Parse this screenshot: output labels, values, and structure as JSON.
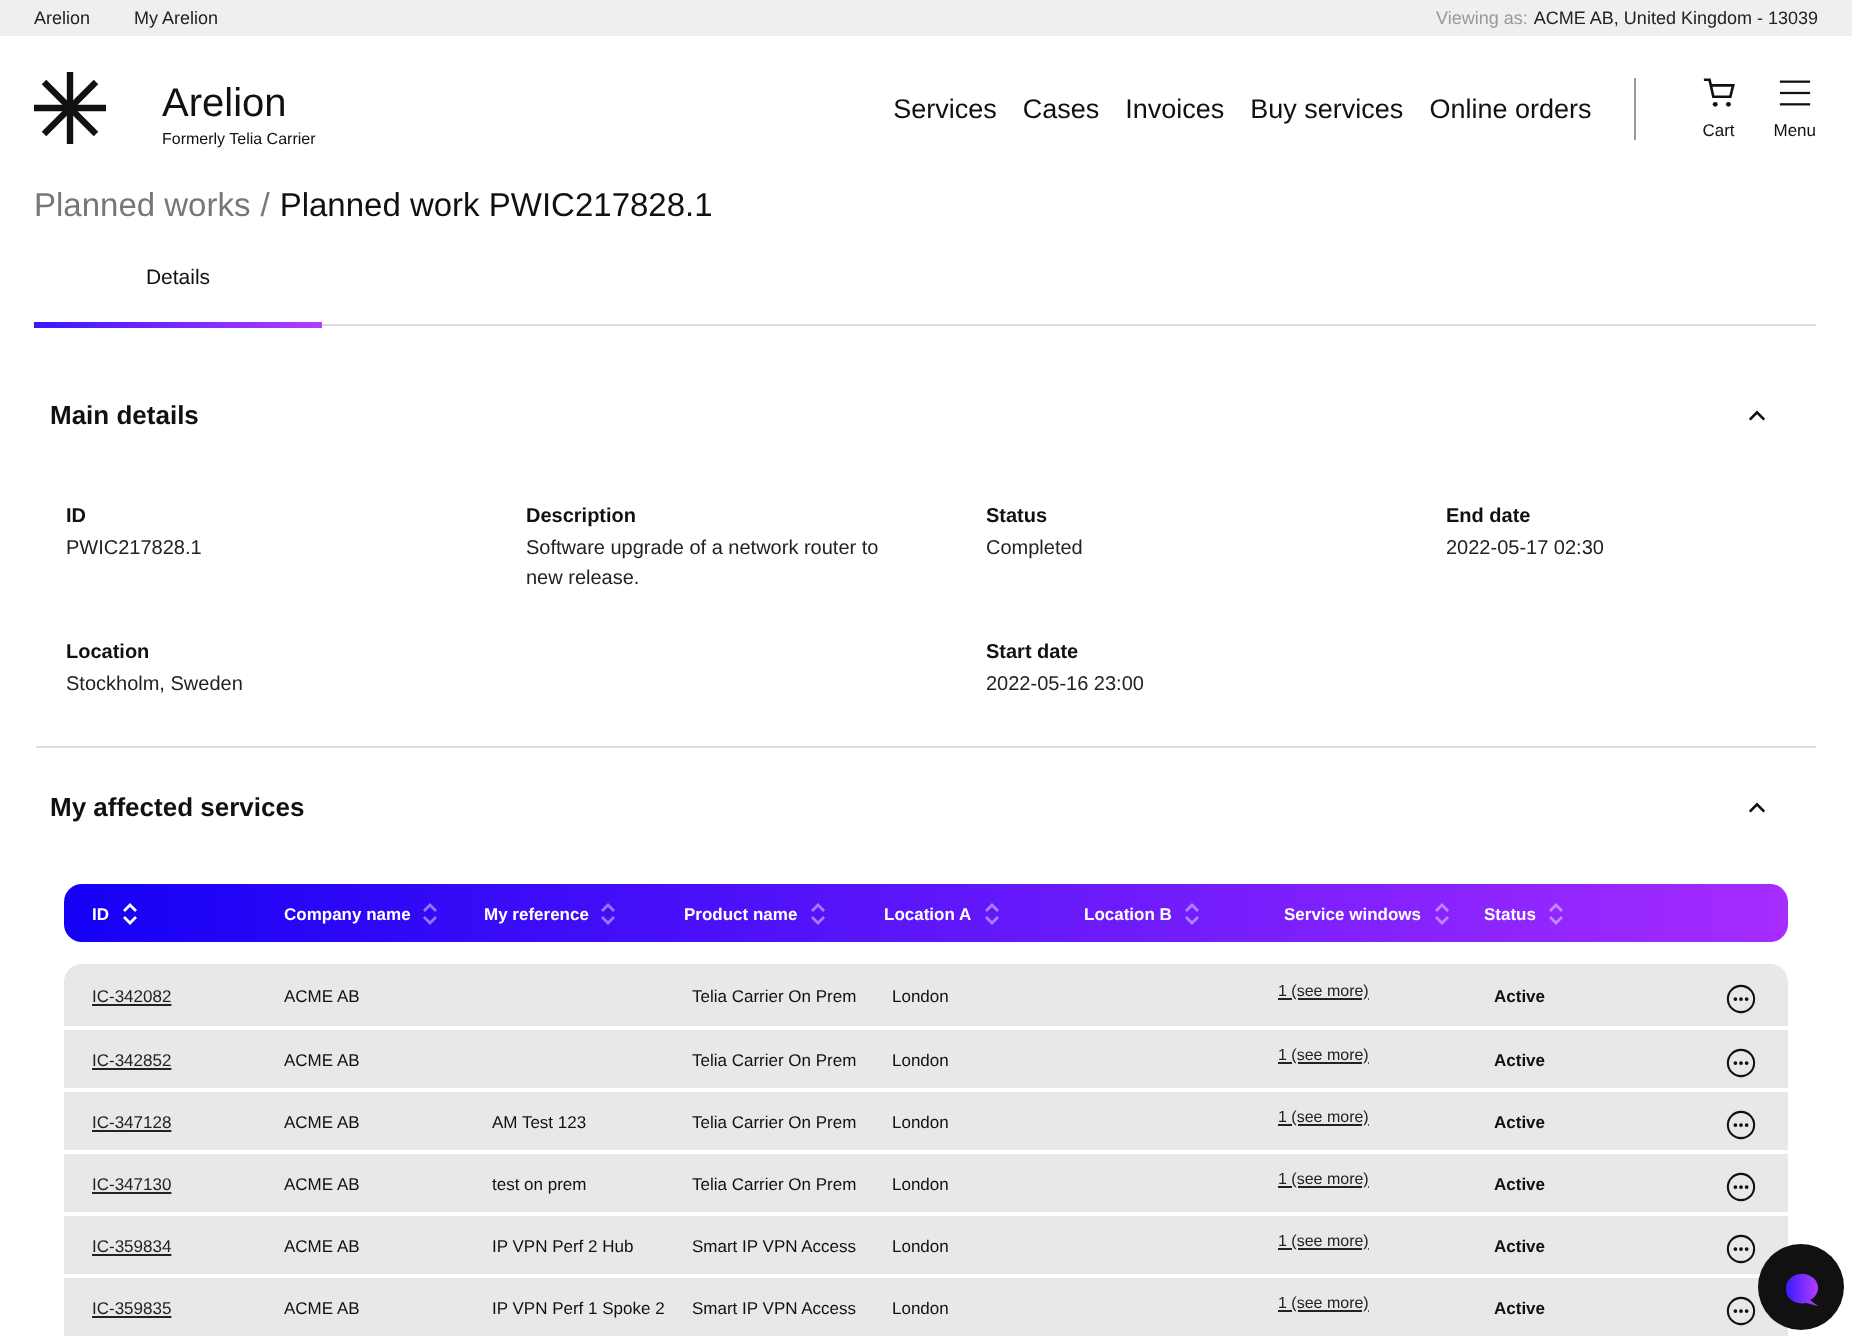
{
  "top_bar": {
    "links": [
      "Arelion",
      "My Arelion"
    ],
    "viewing_label": "Viewing as:",
    "viewing_value": "ACME AB, United Kingdom - 13039"
  },
  "header": {
    "brand": "Arelion",
    "tagline": "Formerly Telia Carrier",
    "nav": [
      "Services",
      "Cases",
      "Invoices",
      "Buy services",
      "Online orders"
    ],
    "cart": "Cart",
    "menu": "Menu"
  },
  "breadcrumb": {
    "parent": "Planned works",
    "separator": "/",
    "current": "Planned work PWIC217828.1"
  },
  "tabs": [
    {
      "label": "Details",
      "selected": true
    }
  ],
  "main_details": {
    "title": "Main details",
    "expanded": true,
    "fields": [
      {
        "label": "ID",
        "value": "PWIC217828.1"
      },
      {
        "label": "Description",
        "value": "Software upgrade of a network router to new release."
      },
      {
        "label": "Status",
        "value": "Completed"
      },
      {
        "label": "End date",
        "value": "2022-05-17 02:30"
      },
      {
        "label": "Location",
        "value": "Stockholm, Sweden"
      },
      {
        "label": "Start date",
        "value": "2022-05-16 23:00"
      }
    ]
  },
  "affected_services": {
    "title": "My affected services",
    "expanded": true,
    "columns": [
      {
        "label": "ID",
        "sorted": true
      },
      {
        "label": "Company name",
        "sorted": false
      },
      {
        "label": "My reference",
        "sorted": false
      },
      {
        "label": "Product name",
        "sorted": false
      },
      {
        "label": "Location A",
        "sorted": false
      },
      {
        "label": "Location B",
        "sorted": false
      },
      {
        "label": "Service windows",
        "sorted": false
      },
      {
        "label": "Status",
        "sorted": false
      }
    ],
    "rows": [
      {
        "id": "IC-342082",
        "company": "ACME AB",
        "reference": "",
        "product": "Telia Carrier On Prem",
        "location_a": "London",
        "location_b": "",
        "service_windows": "1 (see more)",
        "status": "Active"
      },
      {
        "id": "IC-342852",
        "company": "ACME AB",
        "reference": "",
        "product": "Telia Carrier On Prem",
        "location_a": "London",
        "location_b": "",
        "service_windows": "1 (see more)",
        "status": "Active"
      },
      {
        "id": "IC-347128",
        "company": "ACME AB",
        "reference": "AM Test 123",
        "product": "Telia Carrier On Prem",
        "location_a": "London",
        "location_b": "",
        "service_windows": "1 (see more)",
        "status": "Active"
      },
      {
        "id": "IC-347130",
        "company": "ACME AB",
        "reference": "test on prem",
        "product": "Telia Carrier On Prem",
        "location_a": "London",
        "location_b": "",
        "service_windows": "1 (see more)",
        "status": "Active"
      },
      {
        "id": "IC-359834",
        "company": "ACME AB",
        "reference": "IP VPN Perf 2 Hub",
        "product": "Smart IP VPN Access",
        "location_a": "London",
        "location_b": "",
        "service_windows": "1 (see more)",
        "status": "Active"
      },
      {
        "id": "IC-359835",
        "company": "ACME AB",
        "reference": "IP VPN Perf 1 Spoke 2",
        "product": "Smart IP VPN Access",
        "location_a": "London",
        "location_b": "",
        "service_windows": "1 (see more)",
        "status": "Active"
      }
    ]
  }
}
